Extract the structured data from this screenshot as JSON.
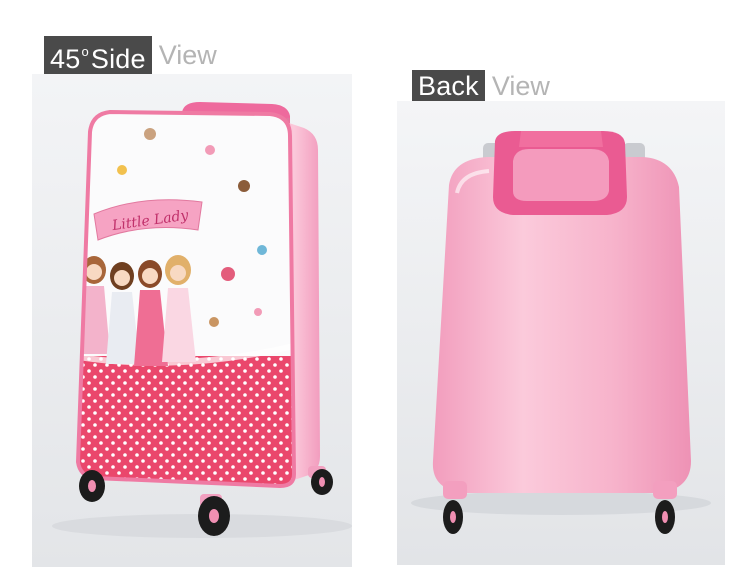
{
  "side_view": {
    "tag_text": "45",
    "degree": "o",
    "tag_word": "Side",
    "rest": "View"
  },
  "back_view": {
    "tag": "Back",
    "rest": "View"
  },
  "illustration": {
    "brand_text": "Little Lady"
  },
  "colors": {
    "label_bg": "#4a4a4a",
    "label_fg": "#ffffff",
    "view_text": "#b4b4b4",
    "backdrop": "#eceef0",
    "shell_pink": "#f6a6c2",
    "handle_pink": "#ec5f96",
    "polka_red": "#e9466b",
    "wheel_black": "#1c1c1c"
  }
}
